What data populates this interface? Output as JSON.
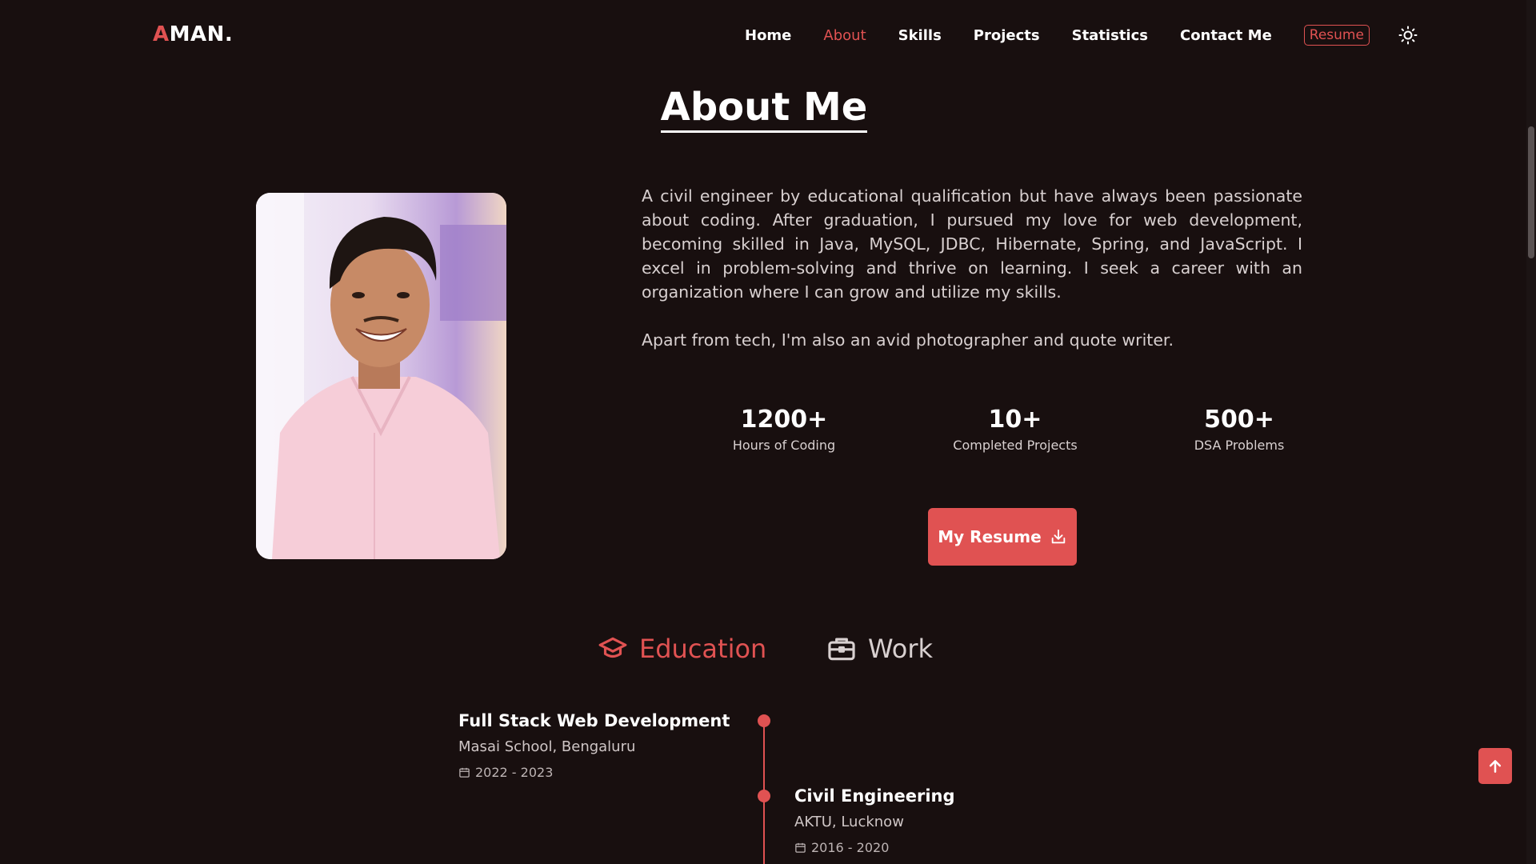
{
  "header": {
    "logo_first": "A",
    "logo_rest": "MAN.",
    "nav": [
      "Home",
      "About",
      "Skills",
      "Projects",
      "Statistics",
      "Contact Me"
    ],
    "active_nav": "About",
    "resume_label": "Resume",
    "theme_icon": "sun-icon"
  },
  "about": {
    "title": "About Me",
    "bio": [
      "A civil engineer by educational qualification but have always been passionate about coding. After graduation, I pursued my love for web development, becoming skilled in Java, MySQL, JDBC, Hibernate, Spring, and JavaScript. I excel in problem-solving and thrive on learning. I seek a career with an organization where I can grow and utilize my skills.",
      "Apart from tech, I'm also an avid photographer and quote writer."
    ],
    "stats": [
      {
        "value": "1200+",
        "label": "Hours of Coding"
      },
      {
        "value": "10+",
        "label": "Completed Projects"
      },
      {
        "value": "500+",
        "label": "DSA Problems"
      }
    ],
    "resume_button": "My Resume",
    "resume_icon": "download-icon"
  },
  "qualification": {
    "tabs": [
      {
        "label": "Education",
        "icon": "graduation-cap-icon",
        "active": true
      },
      {
        "label": "Work",
        "icon": "briefcase-icon",
        "active": false
      }
    ],
    "timeline": [
      {
        "title": "Full Stack Web Development",
        "place": "Masai School, Bengaluru",
        "dates": "2022 - 2023"
      },
      {
        "title": "Civil Engineering",
        "place": "AKTU, Lucknow",
        "dates": "2016 - 2020"
      }
    ]
  },
  "colors": {
    "accent": "#e05252",
    "background": "#180f0f",
    "text": "#ffffff",
    "muted_text": "#d8d0d0"
  },
  "scroll_top_icon": "arrow-up-icon"
}
